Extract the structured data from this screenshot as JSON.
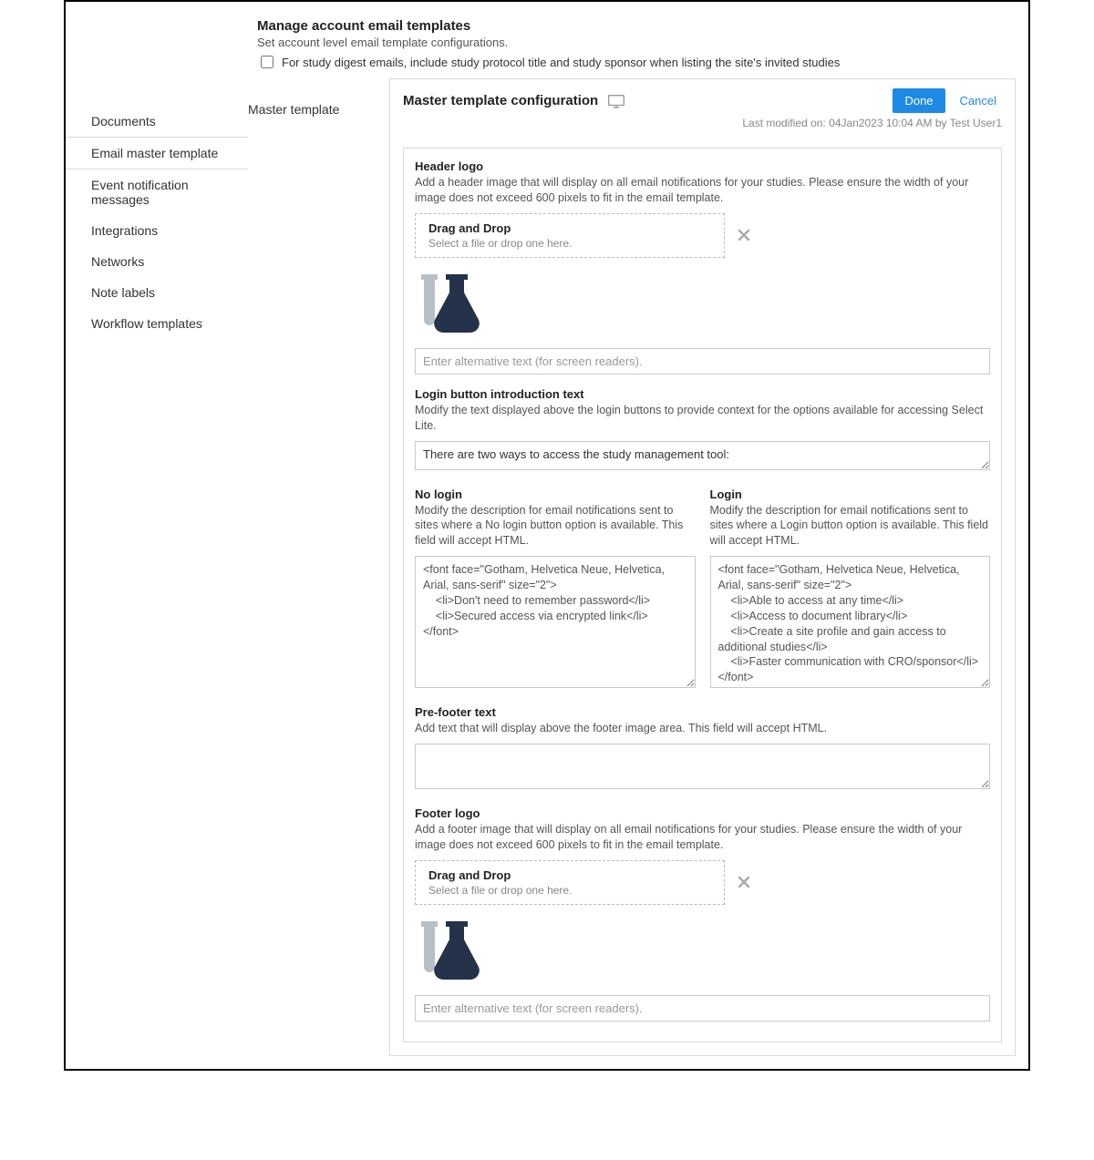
{
  "header": {
    "title": "Manage account email templates",
    "subtitle": "Set account level email template configurations.",
    "digest_checkbox_label": "For study digest emails, include study protocol title and study sponsor when listing the site's invited studies"
  },
  "sidebar": {
    "items": [
      {
        "label": "Documents"
      },
      {
        "label": "Email master template"
      },
      {
        "label": "Event notification messages"
      },
      {
        "label": "Integrations"
      },
      {
        "label": "Networks"
      },
      {
        "label": "Note labels"
      },
      {
        "label": "Workflow templates"
      }
    ],
    "active_index": 1
  },
  "sublabel": "Master template",
  "main": {
    "title": "Master template configuration",
    "done_label": "Done",
    "cancel_label": "Cancel",
    "last_modified": "Last modified on: 04Jan2023 10:04 AM by Test User1"
  },
  "sections": {
    "header_logo": {
      "title": "Header logo",
      "desc": "Add a header image that will display on all email notifications for your studies. Please ensure the width of your image does not exceed 600 pixels to fit in the email template.",
      "drop_title": "Drag and Drop",
      "drop_sub": "Select a file or drop one here.",
      "alt_placeholder": "Enter alternative text (for screen readers)."
    },
    "login_intro": {
      "title": "Login button introduction text",
      "desc": "Modify the text displayed above the login buttons to provide context for the options available for accessing Select Lite.",
      "value": "There are two ways to access the study management tool:"
    },
    "no_login": {
      "title": "No login",
      "desc": "Modify the description for email notifications sent to sites where a No login button option is available. This field will accept HTML.",
      "value": "<font face=\"Gotham, Helvetica Neue, Helvetica, Arial, sans-serif\" size=\"2\">\n    <li>Don't need to remember password</li>\n    <li>Secured access via encrypted link</li>\n</font>"
    },
    "login": {
      "title": "Login",
      "desc": "Modify the description for email notifications sent to sites where a Login button option is available. This field will accept HTML.",
      "value": "<font face=\"Gotham, Helvetica Neue, Helvetica, Arial, sans-serif\" size=\"2\">\n    <li>Able to access at any time</li>\n    <li>Access to document library</li>\n    <li>Create a site profile and gain access to additional studies</li>\n    <li>Faster communication with CRO/sponsor</li>\n</font>"
    },
    "prefooter": {
      "title": "Pre-footer text",
      "desc": "Add text that will display above the footer image area. This field will accept HTML.",
      "value": ""
    },
    "footer_logo": {
      "title": "Footer logo",
      "desc": "Add a footer image that will display on all email notifications for your studies. Please ensure the width of your image does not exceed 600 pixels to fit in the email template.",
      "drop_title": "Drag and Drop",
      "drop_sub": "Select a file or drop one here.",
      "alt_placeholder": "Enter alternative text (for screen readers)."
    }
  }
}
